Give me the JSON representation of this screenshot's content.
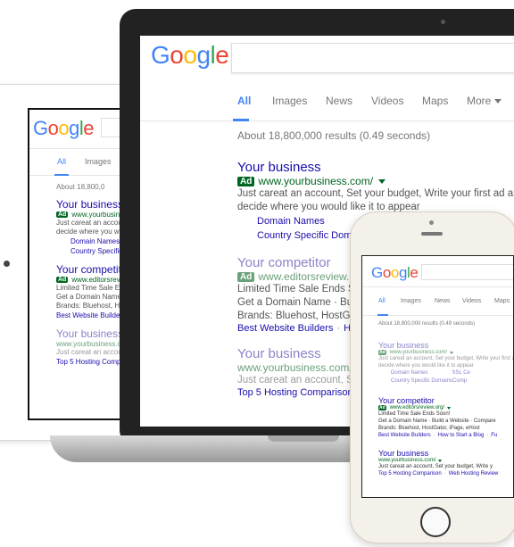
{
  "google_logo": [
    "G",
    "o",
    "o",
    "g",
    "l",
    "e"
  ],
  "tabs": [
    "All",
    "Images",
    "News",
    "Videos",
    "Maps",
    "More"
  ],
  "stats": "About 18,800,000 results (0.49 seconds)",
  "ad_label": "Ad",
  "results": {
    "business_ad": {
      "title": "Your business",
      "url": "www.yourbusiness.com/",
      "desc_line1": "Just careat an account, Set your budget, Write your first ad and",
      "desc_line2": "decide where you would like it to appear",
      "sitelinks": [
        "Domain Names",
        "Country Specific Domains"
      ],
      "sitelinks_right": [
        "SSL Ce",
        "Comp"
      ]
    },
    "competitor_ad": {
      "title": "Your competitor",
      "url": "www.editorsreview.org/",
      "desc_line1": "Limited Time Sale Ends Soon!",
      "desc_line2": "Get a Domain Name · Build a Website · Compare",
      "desc_line3": "Brands: Bluehost, HostGator, iPage, eHost",
      "links": [
        "Best Website Builders",
        "How to Start a Blog",
        "Fu"
      ]
    },
    "business_organic": {
      "title": "Your business",
      "url": "www.yourbusiness.com/",
      "desc_line1": "Just careat an account, Set your budget, Write y",
      "links": [
        "Top 5 Hosting Comparison",
        "Web Hosting Review"
      ]
    }
  },
  "tablet": {
    "visible_tabs": [
      "All",
      "Images"
    ]
  },
  "colors": {
    "google_blue": "#4285f4",
    "google_red": "#ea4335",
    "google_yellow": "#fbbc05",
    "google_green": "#34a853",
    "title_link": "#1a0dab",
    "url_green": "#006621"
  }
}
